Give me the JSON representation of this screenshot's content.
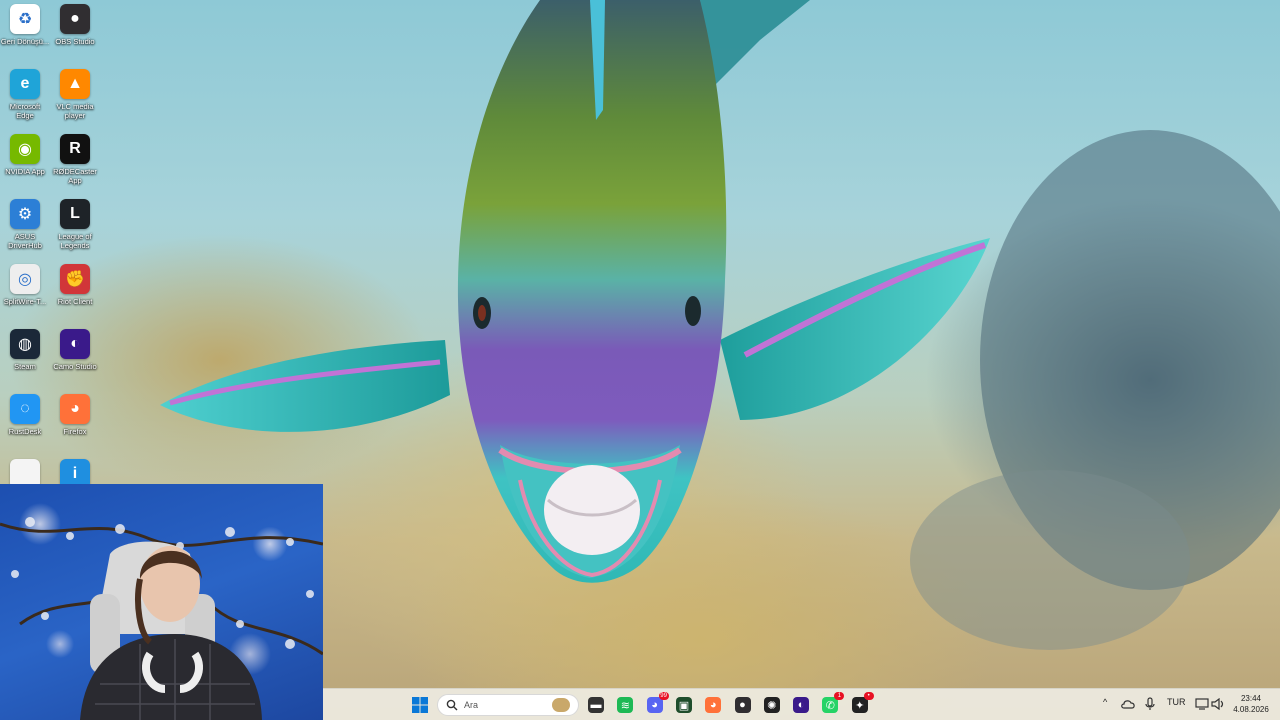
{
  "desktop": {
    "icons_left": [
      {
        "name": "recycle-bin",
        "label": "Geri Dönüşü...",
        "icon": "recycle-bin-icon",
        "color": "#ffffff"
      },
      {
        "name": "microsoft-edge",
        "label": "Microsoft Edge",
        "icon": "edge-icon",
        "color": "#1fa4d8"
      },
      {
        "name": "nvidia-app",
        "label": "NVIDIA App",
        "icon": "nvidia-icon",
        "color": "#76b900"
      },
      {
        "name": "asus-driverhub",
        "label": "ASUS DriverHub",
        "icon": "gear-icon",
        "color": "#2c7fd6"
      },
      {
        "name": "splitwire",
        "label": "SplitWire-T...",
        "icon": "globe-icon",
        "color": "#eeeeee"
      },
      {
        "name": "steam",
        "label": "Steam",
        "icon": "steam-icon",
        "color": "#1b2838"
      },
      {
        "name": "rustdesk",
        "label": "RustDesk",
        "icon": "rustdesk-icon",
        "color": "#2196f3"
      },
      {
        "name": "file",
        "label": "",
        "icon": "file-icon",
        "color": "#f4f4f4"
      }
    ],
    "icons_right": [
      {
        "name": "obs-studio",
        "label": "OBS Studio",
        "icon": "obs-icon",
        "color": "#302e31"
      },
      {
        "name": "vlc",
        "label": "VLC media player",
        "icon": "vlc-cone-icon",
        "color": "#ff8800"
      },
      {
        "name": "rodecaster",
        "label": "RØDECaster App",
        "icon": "rode-icon",
        "color": "#111111"
      },
      {
        "name": "league-of-legends",
        "label": "League of Legends",
        "icon": "lol-icon",
        "color": "#1e2328"
      },
      {
        "name": "riot-client",
        "label": "Riot Client",
        "icon": "riot-icon",
        "color": "#d13639"
      },
      {
        "name": "camo-studio",
        "label": "Camo Studio",
        "icon": "camo-icon",
        "color": "#3a1a8a"
      },
      {
        "name": "firefox",
        "label": "Firefox",
        "icon": "firefox-icon",
        "color": "#ff7139"
      },
      {
        "name": "info-app",
        "label": "",
        "icon": "info-icon",
        "color": "#1f8fe0"
      }
    ]
  },
  "taskbar": {
    "search_placeholder": "Ara",
    "apps": [
      {
        "name": "start-button",
        "icon": "windows-logo-icon",
        "color": "#0078d4"
      },
      {
        "name": "file-explorer",
        "icon": "folder-icon",
        "color": "#333333"
      },
      {
        "name": "spotify",
        "icon": "spotify-icon",
        "color": "#1db954"
      },
      {
        "name": "discord",
        "icon": "discord-icon",
        "color": "#5865f2",
        "badge": "99"
      },
      {
        "name": "terminal-app",
        "icon": "terminal-icon",
        "color": "#1e4d2b"
      },
      {
        "name": "firefox",
        "icon": "firefox-icon",
        "color": "#ff7139"
      },
      {
        "name": "obs-studio",
        "icon": "obs-icon",
        "color": "#302e31"
      },
      {
        "name": "chatgpt",
        "icon": "chatgpt-icon",
        "color": "#222222"
      },
      {
        "name": "camo-studio",
        "icon": "camo-icon",
        "color": "#3a1a8a"
      },
      {
        "name": "whatsapp",
        "icon": "whatsapp-icon",
        "color": "#25d366",
        "badge": "1"
      },
      {
        "name": "davinci-resolve",
        "icon": "resolve-icon",
        "color": "#222222",
        "badge": "•"
      }
    ],
    "tray": {
      "chevron": "^",
      "language": "TUR",
      "time": "23:44",
      "date": "4.08.2026"
    }
  }
}
